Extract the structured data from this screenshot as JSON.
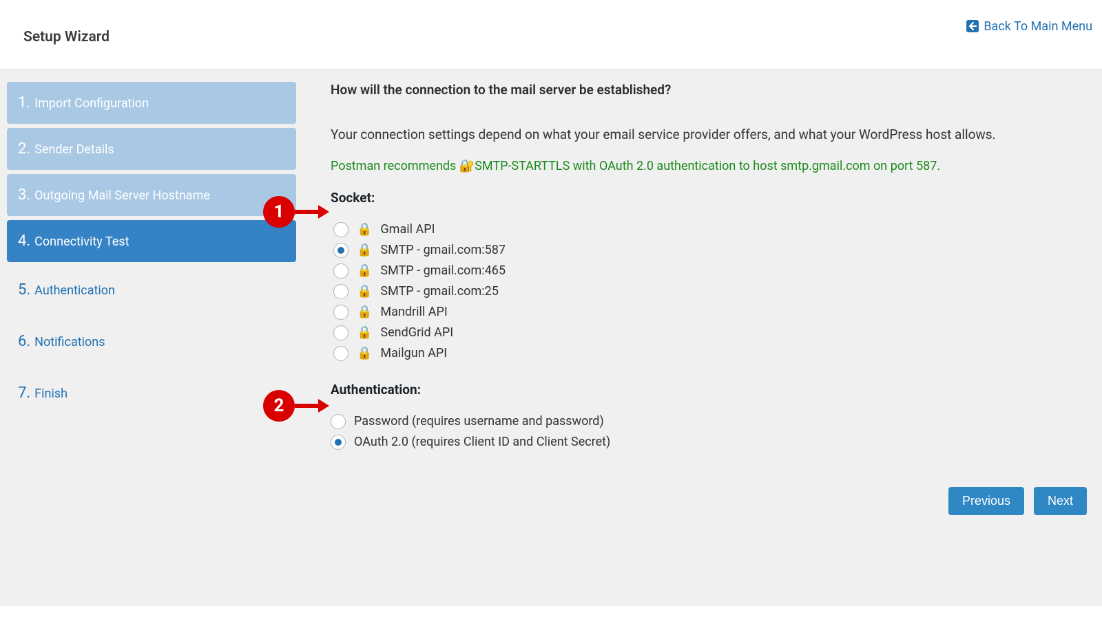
{
  "header": {
    "title": "Setup Wizard",
    "back_label": "Back To Main Menu"
  },
  "sidebar": {
    "steps": [
      {
        "num": "1.",
        "label": "Import Configuration",
        "state": "done"
      },
      {
        "num": "2.",
        "label": "Sender Details",
        "state": "done"
      },
      {
        "num": "3.",
        "label": "Outgoing Mail Server Hostname",
        "state": "done"
      },
      {
        "num": "4.",
        "label": "Connectivity Test",
        "state": "active"
      },
      {
        "num": "5.",
        "label": "Authentication",
        "state": "pending"
      },
      {
        "num": "6.",
        "label": "Notifications",
        "state": "pending"
      },
      {
        "num": "7.",
        "label": "Finish",
        "state": "pending"
      }
    ]
  },
  "main": {
    "question": "How will the connection to the mail server be established?",
    "description": "Your connection settings depend on what your email service provider offers, and what your WordPress host allows.",
    "recommendation_prefix": "Postman recommends ",
    "recommendation_text": "SMTP-STARTTLS with OAuth 2.0 authentication to host smtp.gmail.com on port 587.",
    "socket_title": "Socket:",
    "socket_options": [
      {
        "label": "Gmail API",
        "checked": false
      },
      {
        "label": "SMTP - gmail.com:587",
        "checked": true
      },
      {
        "label": "SMTP - gmail.com:465",
        "checked": false
      },
      {
        "label": "SMTP - gmail.com:25",
        "checked": false
      },
      {
        "label": "Mandrill API",
        "checked": false
      },
      {
        "label": "SendGrid API",
        "checked": false
      },
      {
        "label": "Mailgun API",
        "checked": false
      }
    ],
    "auth_title": "Authentication:",
    "auth_options": [
      {
        "label": "Password (requires username and password)",
        "checked": false
      },
      {
        "label": "OAuth 2.0 (requires Client ID and Client Secret)",
        "checked": true
      }
    ],
    "prev_label": "Previous",
    "next_label": "Next"
  },
  "callouts": {
    "one": "1",
    "two": "2"
  }
}
